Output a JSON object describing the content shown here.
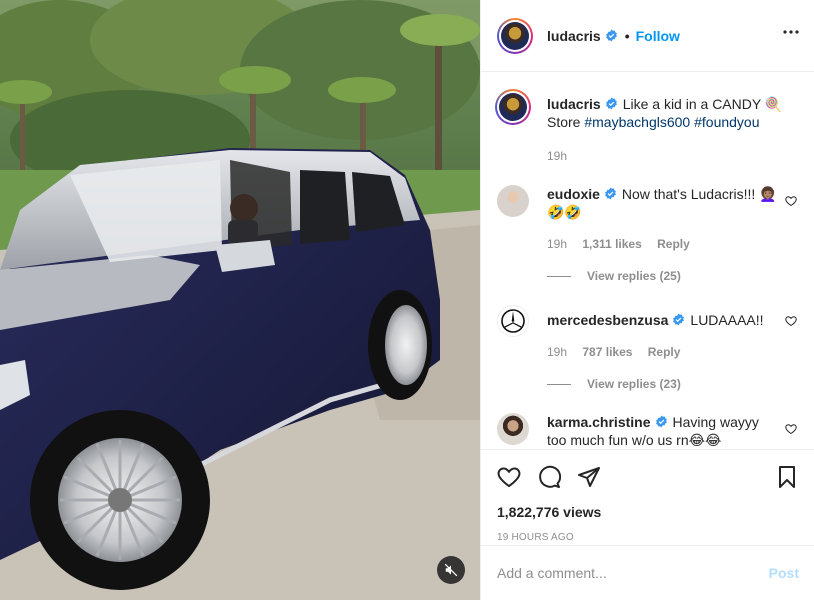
{
  "post": {
    "author": "ludacris",
    "follow_label": "Follow",
    "separator": "•"
  },
  "caption": {
    "username": "ludacris",
    "text": "Like a kid in a CANDY 🍭 Store ",
    "hashtag1": "#maybachgls600",
    "hashtag2": "#foundyou",
    "time": "19h"
  },
  "comments": [
    {
      "username": "eudoxie",
      "text": "Now that's Ludacris!!! 👩🏽‍🦱🤣🤣",
      "time": "19h",
      "likes": "1,311 likes",
      "reply": "Reply",
      "view_replies": "View replies (25)"
    },
    {
      "username": "mercedesbenzusa",
      "text": "LUDAAAA!!",
      "time": "19h",
      "likes": "787 likes",
      "reply": "Reply",
      "view_replies": "View replies (23)"
    },
    {
      "username": "karma.christine",
      "text": "Having wayyy too much fun w/o us rn😂😂"
    }
  ],
  "stats": {
    "views": "1,822,776 views",
    "time_ago": "19 HOURS AGO"
  },
  "add_comment": {
    "placeholder": "Add a comment...",
    "post_label": "Post"
  },
  "icons": {
    "verified": "verified-badge-icon",
    "more": "more-horizontal-icon",
    "like": "heart-icon",
    "comment": "comment-bubble-icon",
    "share": "paper-plane-icon",
    "save": "bookmark-icon",
    "mute": "speaker-muted-icon"
  },
  "colors": {
    "accent": "#0095f6",
    "post_disabled": "#b2dffc",
    "secondary_text": "#8e8e8e",
    "verified": "#3897f0"
  }
}
